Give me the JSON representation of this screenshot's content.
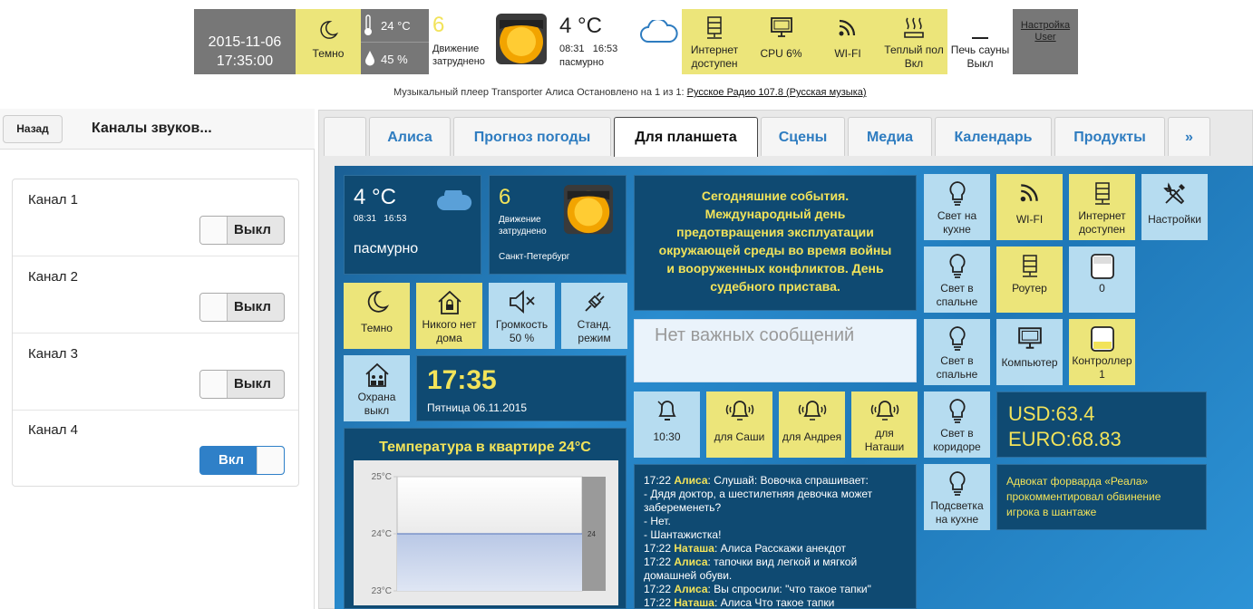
{
  "topbar": {
    "date": "2015-11-06",
    "time": "17:35:00",
    "dark_label": "Темно",
    "temp": "24 °C",
    "humidity": "45 %",
    "traffic_level": "6",
    "traffic_label1": "Движение",
    "traffic_label2": "затруднено",
    "weather_temp": "4 °C",
    "sunrise": "08:31",
    "sunset": "16:53",
    "weather_desc": "пасмурно",
    "internet1": "Интернет",
    "internet2": "доступен",
    "cpu": "CPU 6%",
    "wifi": "WI-FI",
    "floor1": "Теплый пол",
    "floor2": "Вкл",
    "sauna1": "Печь сауны",
    "sauna2": "Выкл",
    "settings": "Настройка",
    "user": "User",
    "player_text": "Музыкальный плеер Transporter Алиса Остановлено на 1 из 1: ",
    "player_link": "Русское Радио 107.8 (Русская музыка)"
  },
  "left_panel": {
    "back": "Назад",
    "title": "Каналы звуков...",
    "channels": [
      {
        "name": "Канал 1",
        "state": "Выкл"
      },
      {
        "name": "Канал 2",
        "state": "Выкл"
      },
      {
        "name": "Канал 3",
        "state": "Выкл"
      },
      {
        "name": "Канал 4",
        "state": "Вкл"
      }
    ]
  },
  "tabs": [
    "Алиса",
    "Прогноз погоды",
    "Для планшета",
    "Сцены",
    "Медиа",
    "Календарь",
    "Продукты",
    "»"
  ],
  "dashboard": {
    "weather_temp": "4 °C",
    "sunrise": "08:31",
    "sunset": "16:53",
    "weather_desc": "пасмурно",
    "traffic_level": "6",
    "traffic1": "Движение",
    "traffic2": "затруднено",
    "city": "Санкт-Петербург",
    "events": "Сегодняшние события. Международный день предотвращения эксплуатации окружающей среды во время войны и вооруженных конфликтов. День судебного пристава.",
    "messages": "Нет важных сообщений",
    "dark": "Темно",
    "nobody1": "Никого нет",
    "nobody2": "дома",
    "volume1": "Громкость",
    "volume2": "50 %",
    "mode1": "Станд.",
    "mode2": "режим",
    "guard1": "Охрана",
    "guard2": "выкл",
    "clock": "17:35",
    "clock_date": "Пятница 06.11.2015",
    "temp_title": "Температура в квартире 24°C",
    "alarm_time": "10:30",
    "alarm_sasha": "для Саши",
    "alarm_andrey": "для Андрея",
    "alarm_natasha1": "для",
    "alarm_natasha2": "Наташи",
    "light_kitchen1": "Свет на",
    "light_kitchen2": "кухне",
    "wifi": "WI-FI",
    "internet1": "Интернет",
    "internet2": "доступен",
    "settings": "Настройки",
    "light_bed_a1": "Свет в",
    "light_bed_a2": "спальне",
    "router": "Роутер",
    "zero": "0",
    "light_bed_b1": "Свет в",
    "light_bed_b2": "спальне",
    "computer": "Компьютер",
    "controller1": "Контроллер",
    "controller2": "1",
    "light_hall1": "Свет в",
    "light_hall2": "коридоре",
    "usd": "USD:63.4",
    "euro": "EURO:68.83",
    "backlight1": "Подсветка",
    "backlight2": "на кухне",
    "news": "Адвокат форварда «Реала» прокомментировал обвинение игрока в шантаже"
  },
  "chat": [
    {
      "time": "17:22",
      "user": "Алиса",
      "text": ": Слушай: Вовочка спрашивает:"
    },
    {
      "time": "",
      "user": "",
      "text": "- Дядя доктор, а шестилетняя девочка может забеременеть?"
    },
    {
      "time": "",
      "user": "",
      "text": "- Нет."
    },
    {
      "time": "",
      "user": "",
      "text": "- Шантажистка!"
    },
    {
      "time": "17:22",
      "user": "Наташа",
      "text": ": Алиса Расскажи анекдот"
    },
    {
      "time": "17:22",
      "user": "Алиса",
      "text": ": тапочки вид легкой и мягкой домашней обуви."
    },
    {
      "time": "17:22",
      "user": "Алиса",
      "text": ": Вы спросили: \"что такое тапки\""
    },
    {
      "time": "17:22",
      "user": "Наташа",
      "text": ": Алиса Что такое тапки"
    }
  ],
  "chart_data": {
    "type": "line",
    "title": "Температура в квартире 24°C",
    "yticks": [
      "25°C",
      "24°C",
      "23°C"
    ],
    "ylim": [
      23,
      25
    ],
    "series": [
      {
        "values": [
          24,
          24,
          24,
          24,
          24
        ]
      }
    ],
    "end_label": "24",
    "grid": true
  }
}
